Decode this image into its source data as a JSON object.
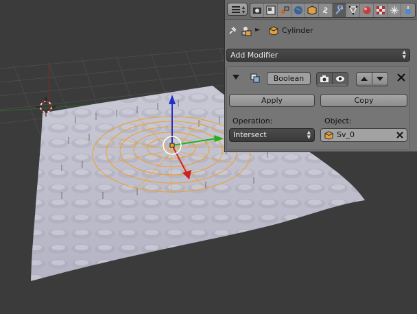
{
  "viewport": {
    "background": "#3b3b3b",
    "mesh_color": "#b8b8c8",
    "selection_color": "#f0a020",
    "axis_x_color": "#22b022",
    "axis_y_color": "#2030d0",
    "axis_z_color": "#d02020"
  },
  "properties": {
    "tabs": [
      "render-icon",
      "render-layers-icon",
      "scene-icon",
      "world-icon",
      "object-icon",
      "constraints-icon",
      "modifiers-icon",
      "data-icon",
      "material-icon",
      "texture-icon",
      "particles-icon",
      "physics-icon"
    ],
    "active_tab": "modifiers-icon",
    "context": {
      "object_name": "Cylinder"
    },
    "add_modifier_label": "Add Modifier",
    "modifier": {
      "name": "Boolean",
      "apply_label": "Apply",
      "copy_label": "Copy",
      "operation_label": "Operation:",
      "operation_value": "Intersect",
      "object_label": "Object:",
      "object_value": "Sv_0"
    }
  }
}
